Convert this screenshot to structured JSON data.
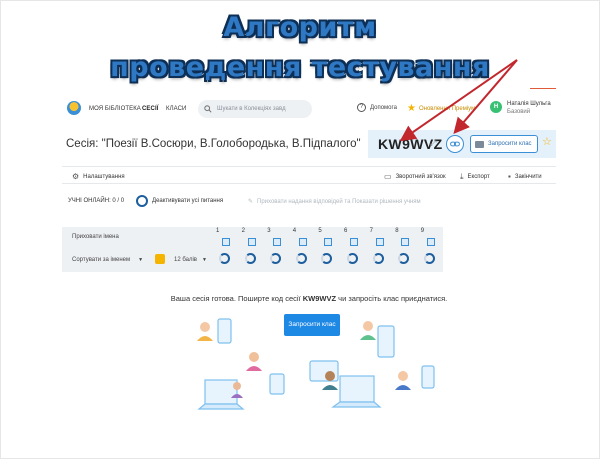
{
  "slide": {
    "title_line1": "Алгоритм",
    "title_line2": "проведення тестування"
  },
  "nav": {
    "my_library": "МОЯ БІБЛІОТЕКА",
    "sessions": "СЕСІЇ",
    "classes": "КЛАСИ",
    "search_placeholder": "Шукати в Колекціях завд",
    "help": "Допомога",
    "premium": "Оновлення Преміум",
    "user_initial": "Н",
    "user_name": "Наталія Шульга",
    "user_plan": "Базовий"
  },
  "session": {
    "title": "Сесія: \"Поезії В.Сосюри, В.Голобородька, В.Підпалого\"",
    "code": "KW9WVZ",
    "invite_class_small": "Запросити клас"
  },
  "toolbar": {
    "settings": "Налаштування",
    "feedback": "Зворотний зв'язок",
    "export": "Експорт",
    "finish": "Закінчити"
  },
  "status": {
    "online_students": "УЧНІ ОНЛАЙН: 0 / 0",
    "deactivate_all": "Деактивувати усі питання",
    "show_answers": "Приховати надання відповідей та Показати рішення учням"
  },
  "grid": {
    "hide_names": "Приховати імена",
    "sort_by_name": "Сортувати за іменем",
    "points": "12 балів",
    "questions": [
      "1",
      "2",
      "3",
      "4",
      "5",
      "6",
      "7",
      "8",
      "9"
    ]
  },
  "ready": {
    "text_before": "Ваша сесія готова. Поширте код сесії ",
    "code": "KW9WVZ",
    "text_after": " чи запросіть клас приєднатися.",
    "invite_button": "Запросити клас"
  },
  "colors": {
    "accent": "#1e88e5",
    "title_blue": "#2f78c4",
    "arrow_red": "#c2272d"
  }
}
